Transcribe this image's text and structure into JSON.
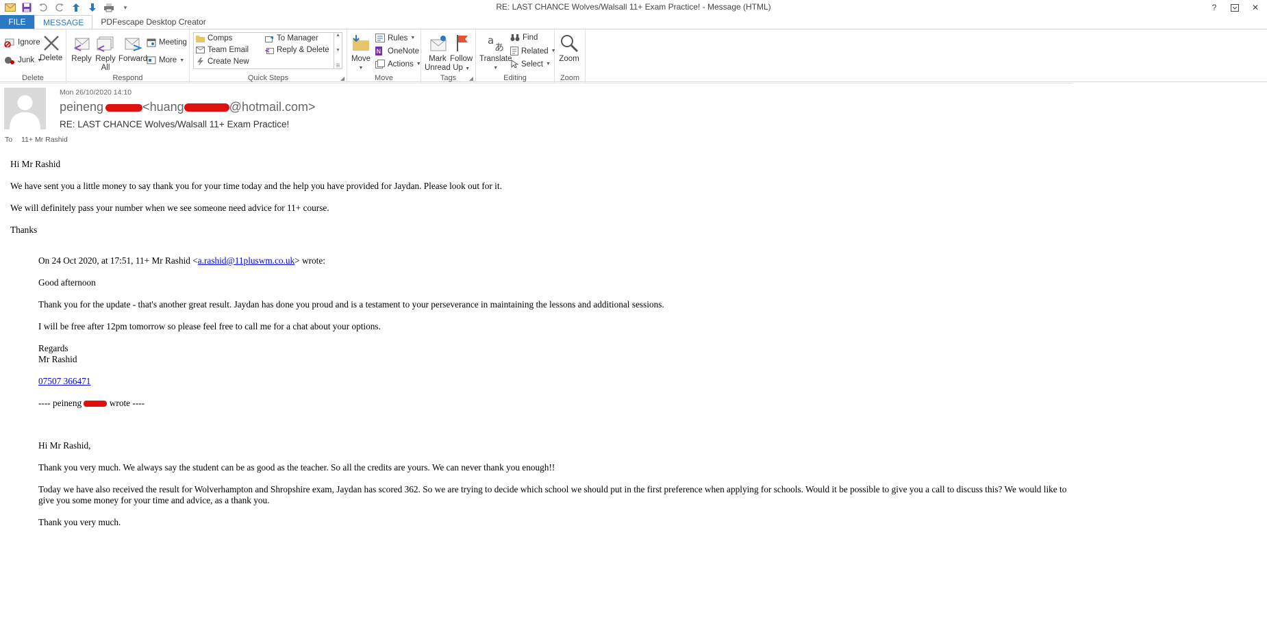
{
  "window": {
    "title": "RE: LAST CHANCE Wolves/Walsall 11+ Exam Practice! - Message (HTML)",
    "help": "?",
    "close": "✕"
  },
  "tabs": [
    "FILE",
    "MESSAGE",
    "PDFescape Desktop Creator"
  ],
  "ribbon": {
    "delete_group": {
      "ignore": "Ignore",
      "junk": "Junk",
      "delete": "Delete",
      "label": "Delete"
    },
    "respond_group": {
      "reply": "Reply",
      "reply_all_1": "Reply",
      "reply_all_2": "All",
      "forward": "Forward",
      "meeting": "Meeting",
      "more": "More",
      "label": "Respond"
    },
    "quick_steps": {
      "comps": "Comps",
      "team_email": "Team Email",
      "create_new": "Create New",
      "to_manager": "To Manager",
      "reply_delete": "Reply & Delete",
      "label": "Quick Steps"
    },
    "move_group": {
      "move": "Move",
      "rules": "Rules",
      "onenote": "OneNote",
      "actions": "Actions",
      "label": "Move"
    },
    "tags_group": {
      "mark_unread_1": "Mark",
      "mark_unread_2": "Unread",
      "follow_up_1": "Follow",
      "follow_up_2": "Up",
      "label": "Tags"
    },
    "editing_group": {
      "translate": "Translate",
      "find": "Find",
      "related": "Related",
      "select": "Select",
      "label": "Editing"
    },
    "zoom_group": {
      "zoom": "Zoom",
      "label": "Zoom"
    }
  },
  "header": {
    "date": "Mon 26/10/2020 14:10",
    "sender_first": "peineng",
    "sender_email_prefix": "<huang",
    "sender_email_suffix": "@hotmail.com>",
    "subject": "RE: LAST CHANCE Wolves/Walsall 11+ Exam Practice!",
    "to_label": "To",
    "to_name": "11+ Mr Rashid"
  },
  "message": {
    "greeting": "Hi Mr Rashid",
    "p1": "We have sent you a little money to say thank you for your time today and the help you have provided for Jaydan. Please look out for it.",
    "p2": "We will definitely pass your number when we see someone need advice for 11+ course.",
    "signoff": "Thanks",
    "quote_intro_pre": "On 24 Oct 2020, at 17:51, 11+ Mr Rashid <",
    "quote_email": "a.rashid@11pluswm.co.uk",
    "quote_intro_post": "> wrote:",
    "q_greeting": "Good afternoon",
    "q_p1": "Thank you for the update - that's another great result. Jaydan has done you proud and is a testament to your perseverance in maintaining the lessons and additional sessions.",
    "q_p2": "I will be free after 12pm tomorrow so please feel free to call me for a chat about your options.",
    "q_regards": "Regards",
    "q_name": "Mr Rashid",
    "q_phone": "07507 366471",
    "q_wrote_pre": "---- peineng",
    "q_wrote_post": "wrote ----",
    "o_greeting": "Hi Mr Rashid,",
    "o_p1": "Thank you very much. We always say the student can be as good as the teacher.  So all the credits are yours. We can never thank you enough!!",
    "o_p2": "Today we have also received the result for Wolverhampton and Shropshire exam, Jaydan has scored 362. So we are trying to decide which school we should put in the first preference when applying for schools.  Would it be possible to give you a call to discuss this? We would like to give you some money for your time and advice, as a thank you.",
    "o_thanks": "Thank you very much."
  },
  "colors": {
    "accent": "#2b78c5",
    "redaction": "#e01010",
    "link": "#0000ee"
  }
}
